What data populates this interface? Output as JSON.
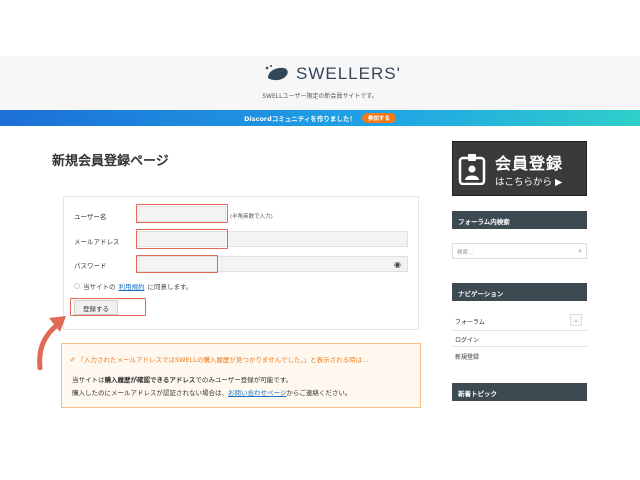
{
  "header": {
    "logo_text": "SWELLERS'",
    "tagline": "SWELLユーザー限定の新会員サイトです。"
  },
  "banner": {
    "text": "Discordコミュニティを作りました！",
    "button_label": "参加する",
    "button_color": "#f07a1a"
  },
  "main": {
    "page_title": "新規会員登録ページ",
    "form": {
      "username_label": "ユーザー名",
      "username_hint": "(半角英数で入力)",
      "email_label": "メールアドレス",
      "password_label": "パスワード",
      "agree_prefix": "当サイトの",
      "agree_link": "利用規約",
      "agree_suffix": "に同意します。",
      "submit_label": "登録する"
    },
    "notice": {
      "title": "「入力されたメールアドレスではSWELLの購入履歴が見つかりませんでした。」と表示される時は…",
      "line1_prefix": "当サイトは",
      "line1_bold": "購入履歴が確認できるアドレス",
      "line1_suffix": "でのみユーザー登録が可能です。",
      "line2_prefix": "購入したのにメールアドレスが認証されない場合は、",
      "line2_link": "お問い合わせページ",
      "line2_suffix": "からご連絡ください。"
    }
  },
  "sidebar": {
    "register_banner": {
      "title": "会員登録",
      "subtitle": "はこちらから ▶"
    },
    "forum_search": {
      "heading": "フォーラム内検索",
      "placeholder": "検索…"
    },
    "navigation": {
      "heading": "ナビゲーション",
      "items": [
        {
          "label": "フォーラム"
        },
        {
          "label": "ログイン"
        },
        {
          "label": "新規登録"
        }
      ]
    },
    "new_topics": {
      "heading": "新着トピック"
    }
  },
  "colors": {
    "highlight": "#e06a55",
    "widget_head": "#3e4a52",
    "link": "#1a73c7"
  }
}
